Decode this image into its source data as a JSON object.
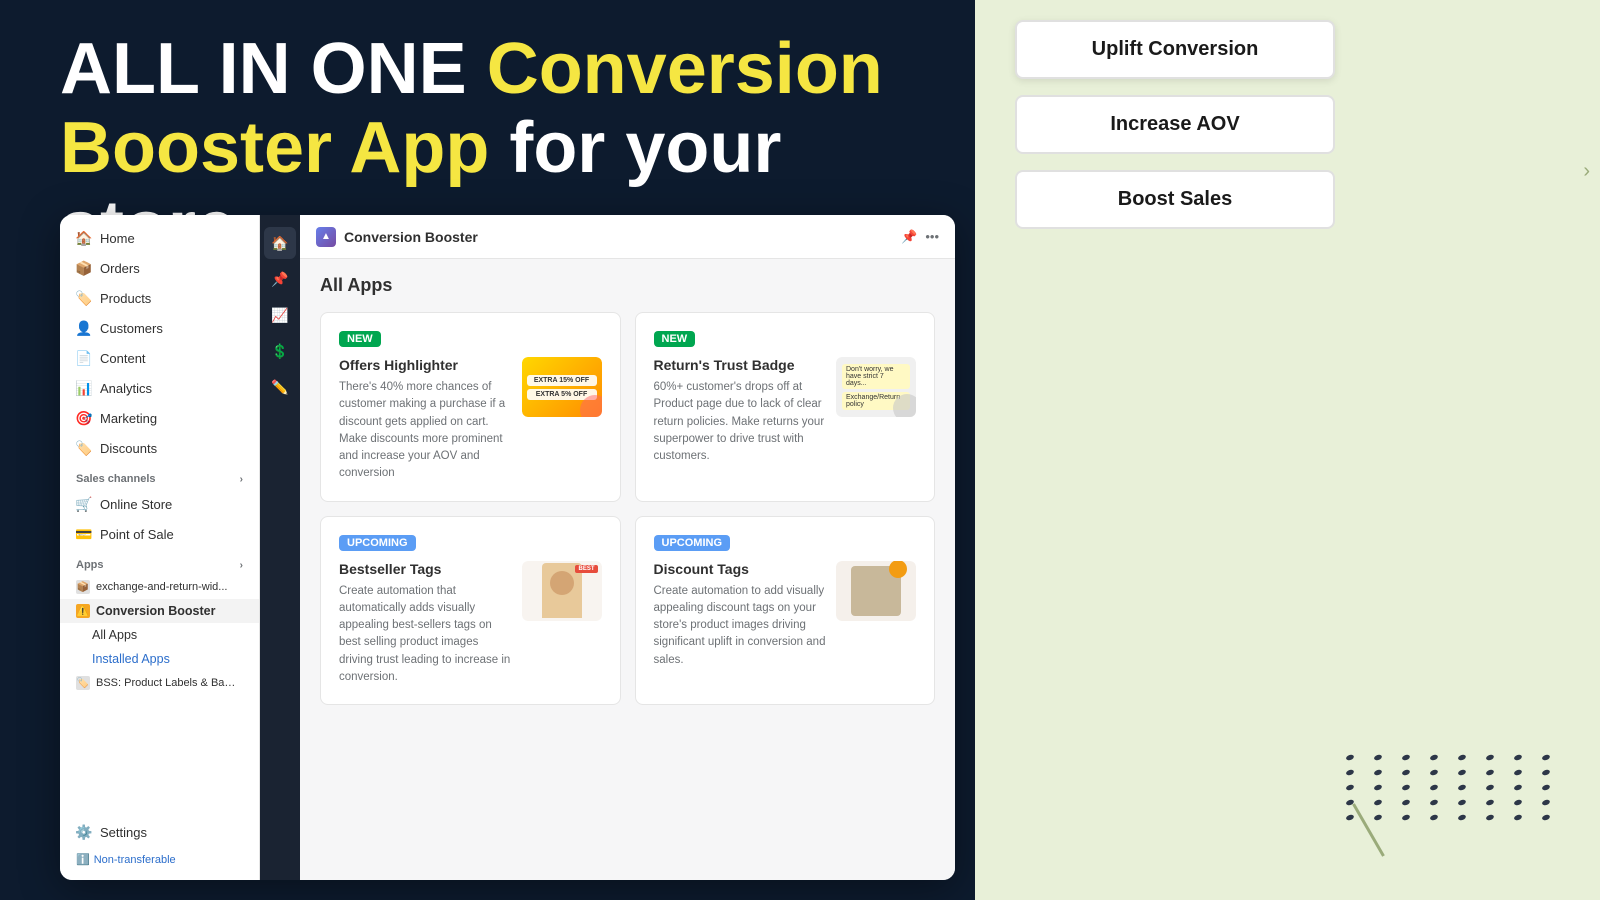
{
  "hero": {
    "line1_white": "ALL IN ONE",
    "line1_yellow": "Conversion",
    "line2_yellow": "Booster App",
    "line2_white": "for your store"
  },
  "cta_buttons": [
    {
      "label": "Uplift Conversion",
      "active": true
    },
    {
      "label": "Increase AOV",
      "active": false
    },
    {
      "label": "Boost Sales",
      "active": false
    }
  ],
  "shopify": {
    "app_name": "Conversion Booster",
    "page_title": "All Apps",
    "sidebar": {
      "nav_items": [
        {
          "label": "Home",
          "icon": "🏠"
        },
        {
          "label": "Orders",
          "icon": "📦"
        },
        {
          "label": "Products",
          "icon": "🏷️"
        },
        {
          "label": "Customers",
          "icon": "👤"
        },
        {
          "label": "Content",
          "icon": "📄"
        },
        {
          "label": "Analytics",
          "icon": "📊"
        },
        {
          "label": "Marketing",
          "icon": "🎯"
        },
        {
          "label": "Discounts",
          "icon": "🏷️"
        }
      ],
      "sales_channels_label": "Sales channels",
      "sales_channels": [
        {
          "label": "Online Store",
          "icon": "🛒"
        },
        {
          "label": "Point of Sale",
          "icon": "💳"
        }
      ],
      "apps_label": "Apps",
      "apps": [
        {
          "label": "exchange-and-return-wid...",
          "icon": "📦"
        },
        {
          "label": "Conversion Booster",
          "icon": "⚠️",
          "active": true
        },
        {
          "sublabel": "All Apps"
        },
        {
          "sublabel": "Installed Apps"
        },
        {
          "label": "BSS: Product Labels & Bad...",
          "icon": "🏷️"
        }
      ],
      "settings_label": "Settings",
      "non_transferable": "Non-transferable"
    },
    "apps_grid": [
      {
        "badge": "NEW",
        "badge_type": "new",
        "title": "Offers Highlighter",
        "description": "There's 40% more chances of customer making a purchase if a discount gets applied on cart. Make discounts more prominent and increase your AOV and conversion",
        "image_type": "offers"
      },
      {
        "badge": "NEW",
        "badge_type": "new",
        "title": "Return's Trust Badge",
        "description": "60%+ customer's drops off at Product page due to lack of clear return policies. Make returns your superpower to drive trust with customers.",
        "image_type": "returns"
      },
      {
        "badge": "Upcoming",
        "badge_type": "upcoming",
        "title": "Bestseller Tags",
        "description": "Create automation that automatically adds visually appealing best-sellers tags on best selling product images driving trust leading to increase in conversion.",
        "image_type": "bestseller"
      },
      {
        "badge": "Upcoming",
        "badge_type": "upcoming",
        "title": "Discount Tags",
        "description": "Create automation to add visually appealing discount tags on your store's product images driving significant uplift in conversion and sales.",
        "image_type": "discount"
      }
    ]
  }
}
